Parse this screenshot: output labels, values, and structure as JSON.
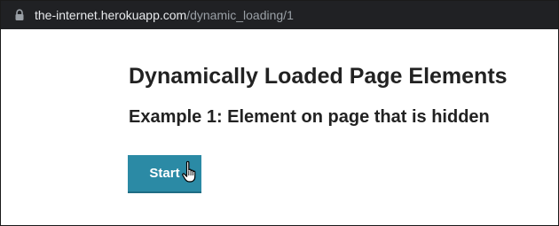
{
  "browser": {
    "url_host": "the-internet.herokuapp.com",
    "url_path": "/dynamic_loading/1",
    "icons": {
      "lock": "lock-icon"
    }
  },
  "page": {
    "title": "Dynamically Loaded Page Elements",
    "subtitle": "Example 1: Element on page that is hidden",
    "start_label": "Start",
    "button_color": "#2b8aa5"
  },
  "pointer": {
    "icon": "hand-pointer-icon"
  }
}
